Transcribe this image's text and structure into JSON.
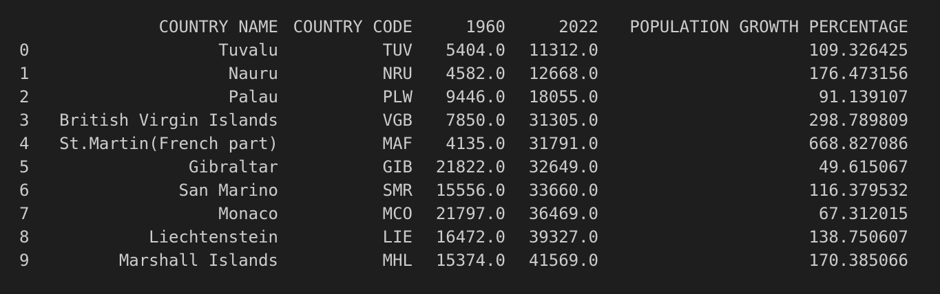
{
  "table": {
    "columns": [
      "COUNTRY NAME",
      "COUNTRY CODE",
      "1960",
      "2022",
      "POPULATION GROWTH PERCENTAGE"
    ],
    "rows": [
      {
        "index": "0",
        "name": "Tuvalu",
        "code": "TUV",
        "y1960": "5404.0",
        "y2022": "11312.0",
        "growth": "109.326425"
      },
      {
        "index": "1",
        "name": "Nauru",
        "code": "NRU",
        "y1960": "4582.0",
        "y2022": "12668.0",
        "growth": "176.473156"
      },
      {
        "index": "2",
        "name": "Palau",
        "code": "PLW",
        "y1960": "9446.0",
        "y2022": "18055.0",
        "growth": "91.139107"
      },
      {
        "index": "3",
        "name": "British Virgin Islands",
        "code": "VGB",
        "y1960": "7850.0",
        "y2022": "31305.0",
        "growth": "298.789809"
      },
      {
        "index": "4",
        "name": "St.Martin(French part)",
        "code": "MAF",
        "y1960": "4135.0",
        "y2022": "31791.0",
        "growth": "668.827086"
      },
      {
        "index": "5",
        "name": "Gibraltar",
        "code": "GIB",
        "y1960": "21822.0",
        "y2022": "32649.0",
        "growth": "49.615067"
      },
      {
        "index": "6",
        "name": "San Marino",
        "code": "SMR",
        "y1960": "15556.0",
        "y2022": "33660.0",
        "growth": "116.379532"
      },
      {
        "index": "7",
        "name": "Monaco",
        "code": "MCO",
        "y1960": "21797.0",
        "y2022": "36469.0",
        "growth": "67.312015"
      },
      {
        "index": "8",
        "name": "Liechtenstein",
        "code": "LIE",
        "y1960": "16472.0",
        "y2022": "39327.0",
        "growth": "138.750607"
      },
      {
        "index": "9",
        "name": "Marshall Islands",
        "code": "MHL",
        "y1960": "15374.0",
        "y2022": "41569.0",
        "growth": "170.385066"
      }
    ]
  }
}
